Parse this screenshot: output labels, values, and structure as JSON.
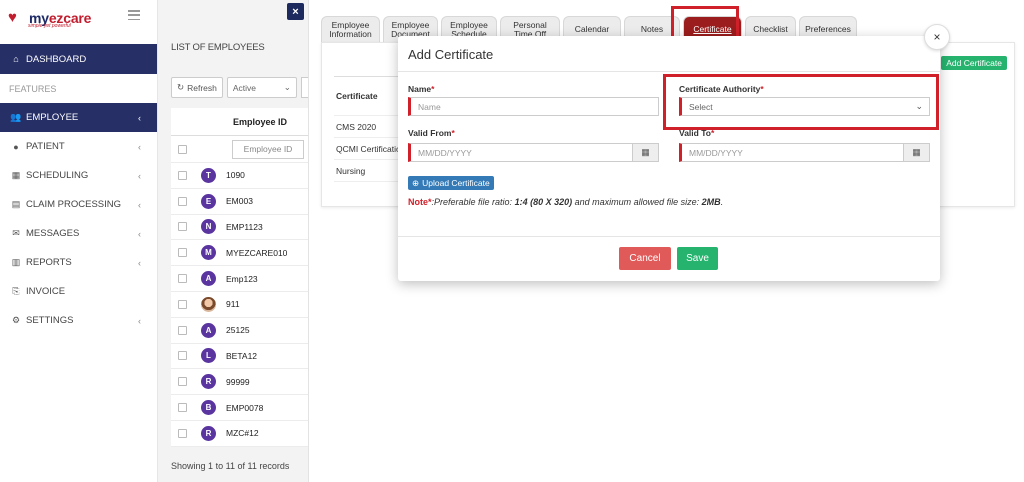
{
  "app": {
    "logo_text_a": "my",
    "logo_text_b": "ezcare",
    "tagline": "simple yet powerful"
  },
  "sidebar": {
    "dashboard": "DASHBOARD",
    "features_label": "FEATURES",
    "items": [
      {
        "label": "EMPLOYEE",
        "icon": "users-icon",
        "chevron": true
      },
      {
        "label": "PATIENT",
        "icon": "user-icon",
        "chevron": true
      },
      {
        "label": "SCHEDULING",
        "icon": "calendar-icon",
        "chevron": true
      },
      {
        "label": "CLAIM PROCESSING",
        "icon": "document-icon",
        "chevron": true
      },
      {
        "label": "MESSAGES",
        "icon": "envelope-icon",
        "chevron": true
      },
      {
        "label": "REPORTS",
        "icon": "bar-chart-icon",
        "chevron": true
      },
      {
        "label": "INVOICE",
        "icon": "invoice-icon",
        "chevron": false
      },
      {
        "label": "SETTINGS",
        "icon": "gear-icon",
        "chevron": true
      }
    ]
  },
  "list": {
    "title": "LIST OF EMPLOYEES",
    "refresh_label": "Refresh",
    "status_select": "Active",
    "column_header": "Employee ID",
    "filter_placeholder": "Employee ID",
    "rows": [
      {
        "initial": "T",
        "id": "1090"
      },
      {
        "initial": "E",
        "id": "EM003"
      },
      {
        "initial": "N",
        "id": "EMP1123"
      },
      {
        "initial": "M",
        "id": "MYEZCARE010"
      },
      {
        "initial": "A",
        "id": "Emp123"
      },
      {
        "initial": "",
        "id": "911",
        "photo": true
      },
      {
        "initial": "A",
        "id": "25125"
      },
      {
        "initial": "L",
        "id": "BETA12"
      },
      {
        "initial": "R",
        "id": "99999"
      },
      {
        "initial": "B",
        "id": "EMP0078"
      },
      {
        "initial": "R",
        "id": "MZC#12"
      }
    ],
    "footer": {
      "showing": "Showing",
      "from": "1",
      "to_word": "to",
      "to": "11",
      "of_word": "of",
      "total": "11",
      "records": "records"
    }
  },
  "tabs": [
    {
      "label": "Employee Information"
    },
    {
      "label": "Employee Document"
    },
    {
      "label": "Employee Schedule"
    },
    {
      "label": "Personal Time Off"
    },
    {
      "label": "Calendar"
    },
    {
      "label": "Notes"
    },
    {
      "label": "Certificate",
      "active": true
    },
    {
      "label": "Checklist"
    },
    {
      "label": "Preferences"
    }
  ],
  "background_table": {
    "header": "Certificate",
    "rows": [
      "CMS 2020",
      "QCMI Certification",
      "Nursing"
    ],
    "add_button": "Add Certificate"
  },
  "modal": {
    "title": "Add Certificate",
    "name_label": "Name",
    "name_placeholder": "Name",
    "authority_label": "Certificate Authority",
    "authority_value": "Select",
    "valid_from_label": "Valid From",
    "valid_from_placeholder": "MM/DD/YYYY",
    "valid_to_label": "Valid To",
    "valid_to_placeholder": "MM/DD/YYYY",
    "upload_label": "Upload Certificate",
    "note_prefix": "Note",
    "note_text": ":Preferable file ratio: ",
    "note_ratio": "1:4 (80 X 320)",
    "note_mid": " and maximum allowed file size: ",
    "note_size": "2MB",
    "note_end": ".",
    "cancel_label": "Cancel",
    "save_label": "Save",
    "close_glyph": "×",
    "required_mark": "*"
  },
  "colors": {
    "navy": "#262f66",
    "accent_red": "#d0202a",
    "save_green": "#26b36e",
    "cancel_red": "#e05a5a",
    "upload_blue": "#337ab7",
    "avatar_purple": "#5a35a0"
  }
}
